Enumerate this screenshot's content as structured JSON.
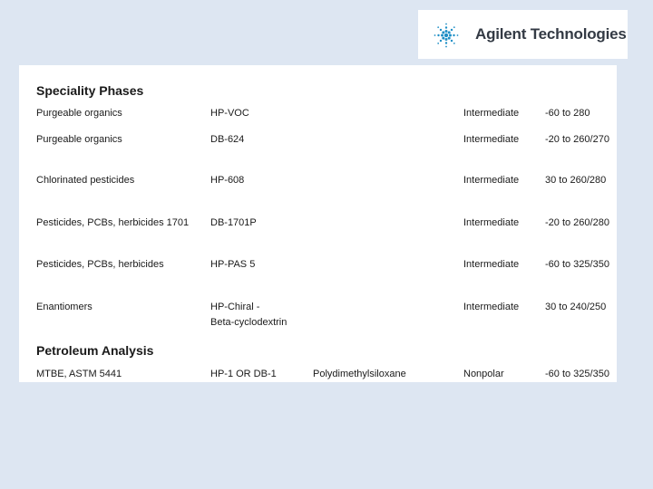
{
  "logo": {
    "text": "Agilent Technologies",
    "icon": "agilent-spark-icon",
    "color": "#1f8fc6"
  },
  "sections": [
    {
      "title": "Speciality Phases",
      "rows": [
        {
          "application": "Purgeable organics",
          "column": "HP-VOC",
          "column2": "",
          "phase": "",
          "polarity": "Intermediate",
          "temp": "-60 to 280"
        },
        {
          "application": "Purgeable organics",
          "column": "DB-624",
          "column2": "",
          "phase": "",
          "polarity": "Intermediate",
          "temp": "-20 to 260/270"
        },
        {
          "application": "Chlorinated pesticides",
          "column": "HP-608",
          "column2": "",
          "phase": "",
          "polarity": "Intermediate",
          "temp": "30 to 260/280"
        },
        {
          "application": "Pesticides, PCBs, herbicides 1701",
          "column": "DB-1701P",
          "column2": "",
          "phase": "",
          "polarity": "Intermediate",
          "temp": "-20 to 260/280"
        },
        {
          "application": "Pesticides, PCBs, herbicides",
          "column": "HP-PAS 5",
          "column2": "",
          "phase": "",
          "polarity": "Intermediate",
          "temp": "-60 to 325/350"
        },
        {
          "application": "Enantiomers",
          "column": "HP-Chiral -",
          "column2": "Beta-cyclodextrin",
          "phase": "",
          "polarity": "Intermediate",
          "temp": "30 to 240/250"
        }
      ]
    },
    {
      "title": "Petroleum Analysis",
      "rows": [
        {
          "application": "MTBE, ASTM 5441",
          "column": "HP-1 OR DB-1",
          "column2": "",
          "phase": "Polydimethylsiloxane",
          "polarity": "Nonpolar",
          "temp": "-60 to 325/350"
        }
      ]
    }
  ]
}
